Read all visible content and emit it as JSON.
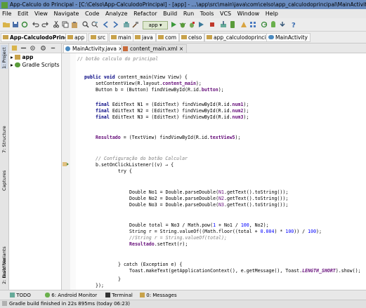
{
  "window": {
    "title": "App-Calculo do Principal - [C:\\Celso\\App-CalculodoPrincipal] - [app] - ...\\app\\src\\main\\java\\com\\celso\\app_calculodoprincipal\\MainActivity.java - Android Studio 1.4"
  },
  "menu": [
    "File",
    "Edit",
    "View",
    "Navigate",
    "Code",
    "Analyze",
    "Refactor",
    "Build",
    "Run",
    "Tools",
    "VCS",
    "Window",
    "Help"
  ],
  "toolbar": {
    "run_config": "app"
  },
  "breadcrumb": [
    "App-CalculodoPrincipal",
    "app",
    "src",
    "main",
    "java",
    "com",
    "celso",
    "app_calculodoprincipal",
    "MainActivity"
  ],
  "left_strip": [
    "1: Project",
    "7: Structure",
    "Captures",
    "Build Variants",
    "2: Favorites"
  ],
  "project": {
    "tree": [
      {
        "label": "app",
        "icon": "folder-icon"
      },
      {
        "label": "Gradle Scripts",
        "icon": "gradle-icon"
      }
    ]
  },
  "editor": {
    "tabs": [
      {
        "label": "MainActivity.java",
        "active": true
      },
      {
        "label": "content_main.xml",
        "active": false
      }
    ]
  },
  "code": {
    "line1": "// botão calculo do principal",
    "line2_a": "public void ",
    "line2_b": "content_main(View View) {",
    "line3_a": "setContentView(R.layout.",
    "line3_b": "content_main",
    "line3_c": ");",
    "line4_a": "Button b = (Button) findViewById(R.id.",
    "line4_b": "button",
    "line4_c": ");",
    "n1_a": "final ",
    "n1_b": "EditText N1 = (EditText) findViewById(R.id.",
    "n1_c": "num1",
    "n1_d": ");",
    "n2_a": "final ",
    "n2_b": "EditText N2 = (EditText) findViewById(R.id.",
    "n2_c": "num2",
    "n2_d": ");",
    "n3_a": "final ",
    "n3_b": "EditText N3 = (EditText) findViewById(R.id.",
    "n3_c": "num3",
    "n3_d": ");",
    "res_a": "Resultado",
    "res_b": " = (TextView) findViewById(R.id.",
    "res_c": "textView5",
    "res_d": ");",
    "cfg": "// Configuração do botão Calcular",
    "listener": "b.setOnClickListener((v) → {",
    "try": "try {",
    "no1_a": "Double No1 = Double.parseDouble(",
    "no1_b": "N1",
    "no1_c": ".getText().toString());",
    "no2_a": "Double No2 = Double.parseDouble(",
    "no2_b": "N2",
    "no2_c": ".getText().toString());",
    "no3_a": "Double No3 = Double.parseDouble(",
    "no3_b": "N3",
    "no3_c": ".getText().toString());",
    "total_a": "Double total = No3 / Math.pow(",
    "total_b": "1",
    "total_c": " + No1 / ",
    "total_d": "100",
    "total_e": ", No2);",
    "str_a": "String r = String.valueOf((Math.floor((total + ",
    "str_b": "0.004",
    "str_c": ") * ",
    "str_d": "100",
    "str_e": ")) / ",
    "str_f": "100",
    "str_g": ");",
    "cmt2": "//String r = String.valueOf(total);",
    "set_a": "Resultado",
    "set_b": ".setText(r);",
    "catch": "} catch (Exception e) {",
    "toast_a": "Toast.makeText(getApplicationContext(), e.getMessage(), Toast.",
    "toast_b": "LENGTH_SHORT",
    "toast_c": ").show();",
    "close1": "}",
    "close2": "});"
  },
  "tool_windows": [
    "TODO",
    "6: Android Monitor",
    "Terminal",
    "0: Messages"
  ],
  "status": "Gradle build finished in 22s 895ms (today 06:23)"
}
